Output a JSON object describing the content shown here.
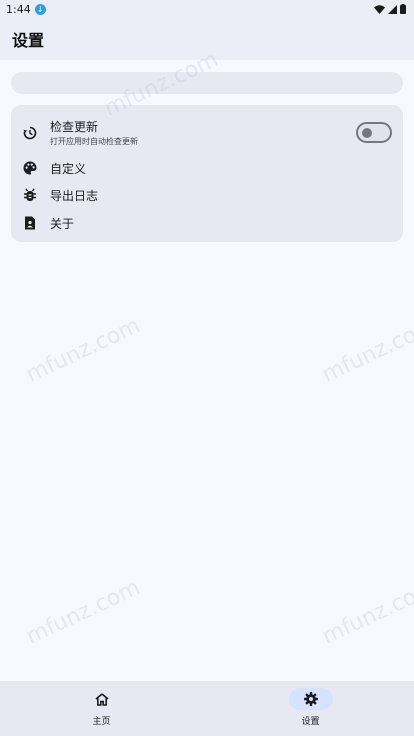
{
  "status_bar": {
    "time": "1:44"
  },
  "app_bar": {
    "title": "设置"
  },
  "settings": {
    "items": [
      {
        "label": "检查更新",
        "subtitle": "打开应用时自动检查更新",
        "icon": "update-history-icon",
        "toggle_on": false
      },
      {
        "label": "自定义",
        "icon": "palette-icon"
      },
      {
        "label": "导出日志",
        "icon": "bug-icon"
      },
      {
        "label": "关于",
        "icon": "about-contact-icon"
      }
    ]
  },
  "watermark": "mfunz.com",
  "bottom_nav": {
    "items": [
      {
        "label": "主页",
        "icon": "home-icon",
        "selected": false
      },
      {
        "label": "设置",
        "icon": "gear-icon",
        "selected": true
      }
    ]
  },
  "colors": {
    "accent_pill": "#d6e3ff",
    "surface": "#e6e9f2",
    "background": "#f6f9ff"
  }
}
